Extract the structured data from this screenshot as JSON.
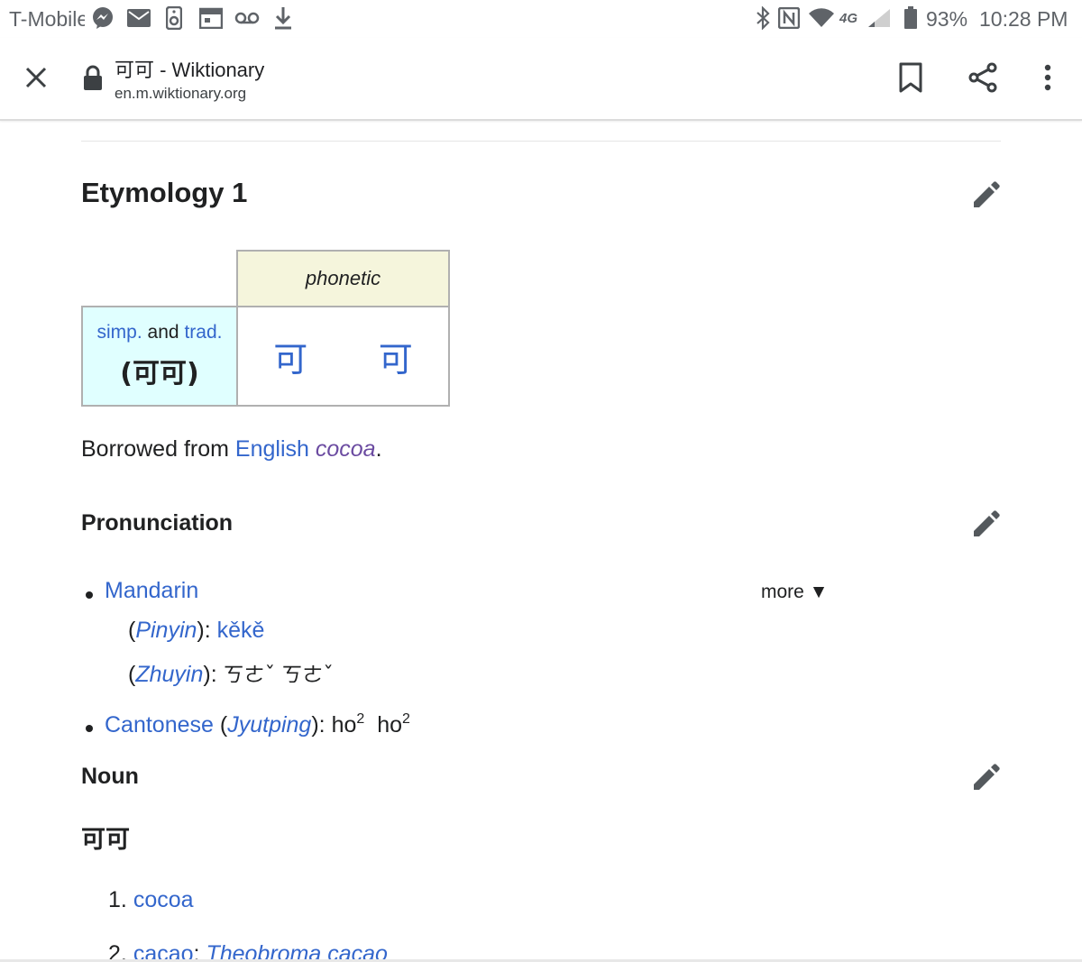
{
  "status_bar": {
    "carrier": "T-Mobile",
    "battery": "93%",
    "time": "10:28 PM",
    "icons_left": [
      "messenger-icon",
      "mail-icon",
      "notification-icon",
      "calendar-icon",
      "voicemail-icon",
      "download-icon"
    ],
    "icons_right": [
      "bluetooth-icon",
      "nfc-icon",
      "wifi-icon",
      "lte-icon",
      "signal-icon",
      "battery-icon"
    ],
    "network_label": "4G"
  },
  "toolbar": {
    "title": "可可 - Wiktionary",
    "url": "en.m.wiktionary.org",
    "icons": [
      "close-icon",
      "lock-icon",
      "bookmark-icon",
      "share-icon",
      "more-vert-icon"
    ]
  },
  "etymology": {
    "heading": "Etymology 1",
    "table": {
      "phonetic_label": "phonetic",
      "simp": "simp.",
      "and": "and",
      "trad": "trad.",
      "form": "(可可)",
      "chars": [
        "可",
        "可"
      ]
    },
    "text_prefix": "Borrowed from",
    "text_lang": "English",
    "text_word": "cocoa",
    "text_suffix": "."
  },
  "pronunciation": {
    "heading": "Pronunciation",
    "more_label": "more ▼",
    "mandarin": {
      "label": "Mandarin",
      "pinyin_label": "Pinyin",
      "pinyin_value": "kěkě",
      "zhuyin_label": "Zhuyin",
      "zhuyin_value": "ㄎㄜˇ ㄎㄜˇ"
    },
    "cantonese": {
      "label": "Cantonese",
      "jyutping_label": "Jyutping",
      "syllable": "ho",
      "tone": "2"
    }
  },
  "noun": {
    "heading": "Noun",
    "headword": "可可",
    "definitions": [
      {
        "number": "1.",
        "text": "cocoa"
      },
      {
        "number": "2.",
        "text": "cacao",
        "sep": ";",
        "extra": "Theobroma cacao"
      }
    ]
  },
  "colors": {
    "link": "#3366cc",
    "visited_link": "#6b4ba1",
    "phonetic_bg": "#f5f5dc",
    "form_bg": "#e0ffff",
    "text": "#202122"
  }
}
